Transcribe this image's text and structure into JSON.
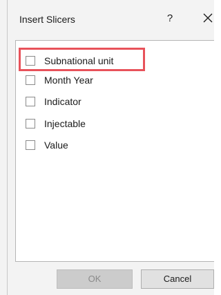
{
  "dialog": {
    "title": "Insert Slicers",
    "help_label": "?",
    "close_icon": "close-icon"
  },
  "fields": [
    {
      "label": "Subnational unit",
      "checked": false,
      "highlighted": true
    },
    {
      "label": "Month Year",
      "checked": false
    },
    {
      "label": "Indicator",
      "checked": false
    },
    {
      "label": "Injectable",
      "checked": false
    },
    {
      "label": "Value",
      "checked": false
    }
  ],
  "buttons": {
    "ok_label": "OK",
    "ok_enabled": false,
    "cancel_label": "Cancel"
  },
  "colors": {
    "highlight": "#e8525a",
    "dialog_background": "#f3f3f3"
  }
}
